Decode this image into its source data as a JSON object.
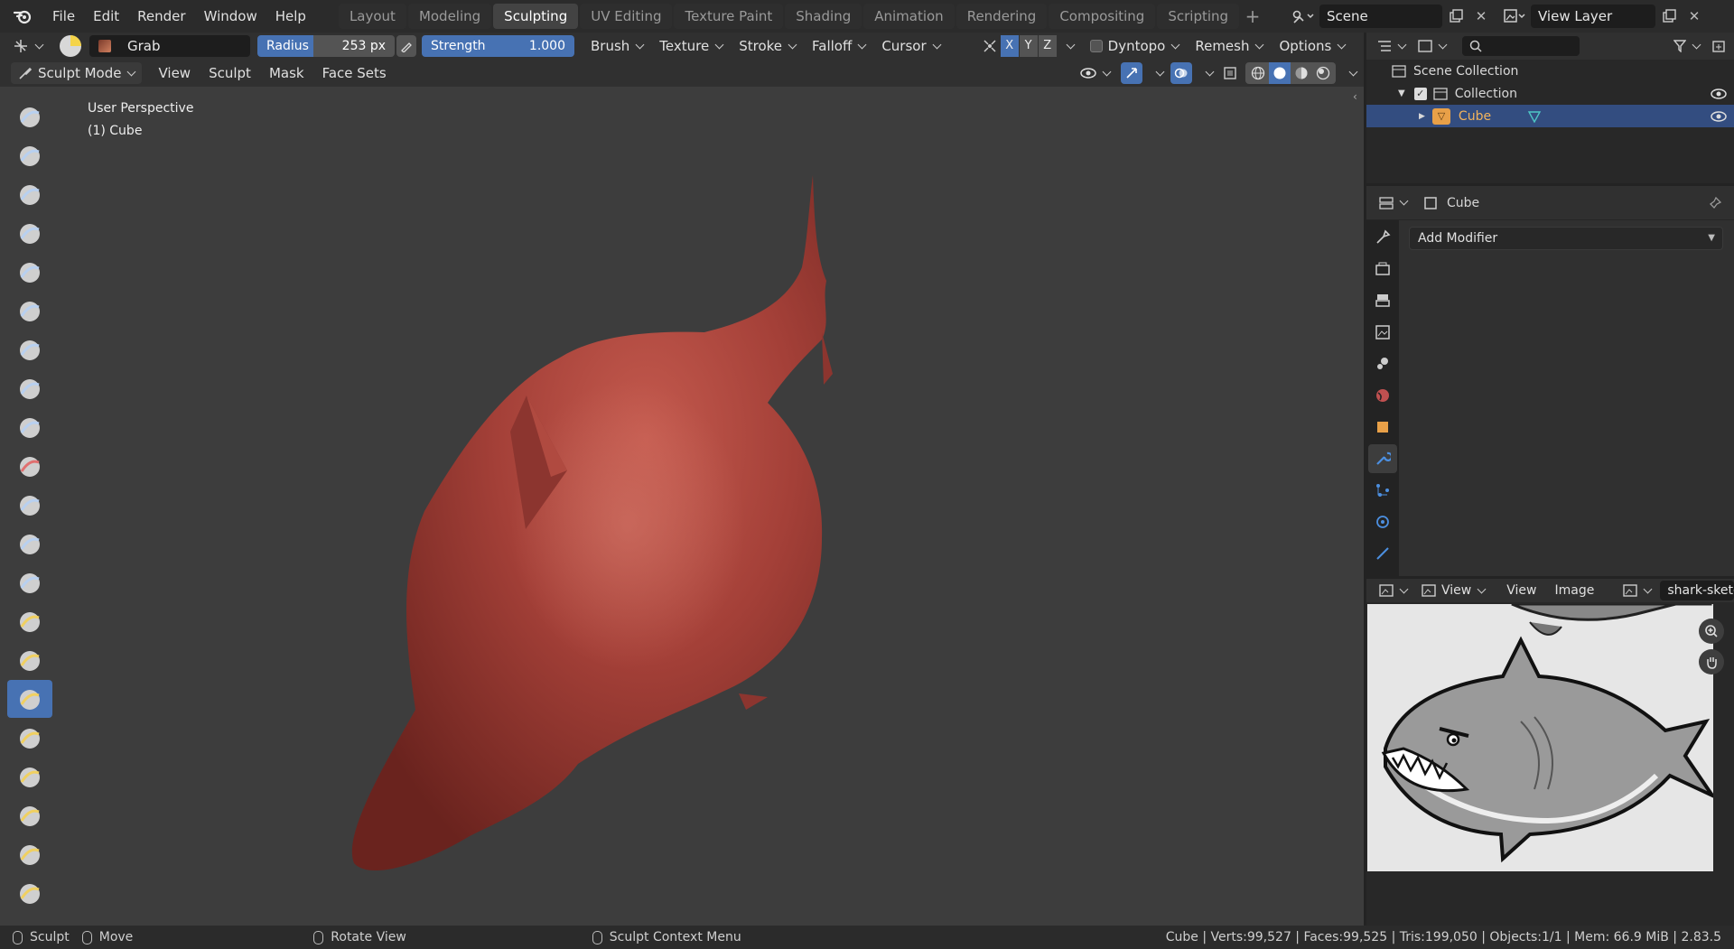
{
  "menu": [
    "File",
    "Edit",
    "Render",
    "Window",
    "Help"
  ],
  "workspaces": [
    "Layout",
    "Modeling",
    "Sculpting",
    "UV Editing",
    "Texture Paint",
    "Shading",
    "Animation",
    "Rendering",
    "Compositing",
    "Scripting"
  ],
  "active_workspace": "Sculpting",
  "scene_name": "Scene",
  "view_layer": "View Layer",
  "tool_header": {
    "brush_name": "Grab",
    "radius_label": "Radius",
    "radius_value": "253 px",
    "strength_label": "Strength",
    "strength_value": "1.000",
    "brush": "Brush",
    "texture": "Texture",
    "stroke": "Stroke",
    "falloff": "Falloff",
    "cursor": "Cursor",
    "axes": [
      "X",
      "Y",
      "Z"
    ],
    "dyntopo": "Dyntopo",
    "remesh": "Remesh",
    "options": "Options"
  },
  "mode_header": {
    "mode": "Sculpt Mode",
    "view": "View",
    "sculpt": "Sculpt",
    "mask": "Mask",
    "face_sets": "Face Sets"
  },
  "viewport": {
    "line1": "User Perspective",
    "line2": "(1) Cube"
  },
  "outliner": {
    "root": "Scene Collection",
    "collection": "Collection",
    "object": "Cube"
  },
  "properties": {
    "object_name": "Cube",
    "add_modifier": "Add Modifier"
  },
  "image_editor": {
    "view_menu_1": "View",
    "view_menu_2": "View",
    "image_menu": "Image",
    "image_name": "shark-sketche"
  },
  "status_bar": {
    "sculpt": "Sculpt",
    "move": "Move",
    "rotate": "Rotate View",
    "context": "Sculpt Context Menu",
    "stats": "Cube | Verts:99,527 | Faces:99,525 | Tris:199,050 | Objects:1/1 | Mem: 66.9 MiB | 2.83.5"
  },
  "colors": {
    "accent": "#4772b3",
    "mesh": "#a8473f",
    "selected_object": "#e8a048"
  }
}
